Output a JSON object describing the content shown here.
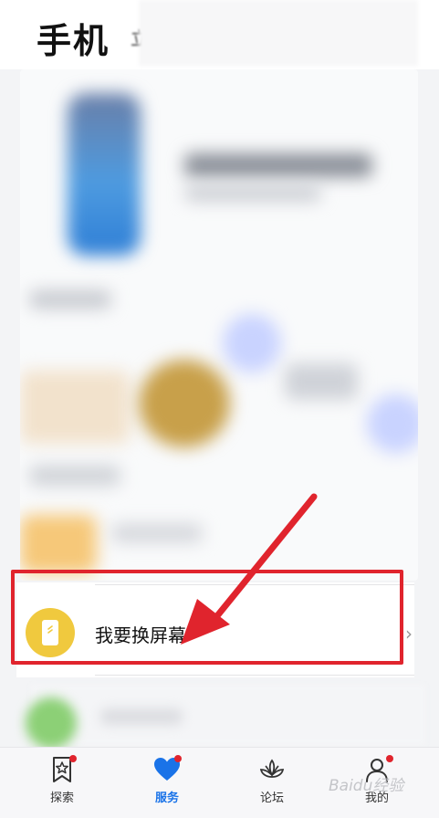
{
  "header": {
    "title": "手机",
    "extra": "立"
  },
  "list": {
    "item_label": "我要换屏幕",
    "chevron": "›"
  },
  "tabs": [
    {
      "label": "探索",
      "icon": "bookmark-star-icon",
      "badge": true
    },
    {
      "label": "服务",
      "icon": "heart-icon",
      "badge": true,
      "active": true
    },
    {
      "label": "论坛",
      "icon": "lotus-icon",
      "badge": false
    },
    {
      "label": "我的",
      "icon": "person-icon",
      "badge": true
    }
  ],
  "watermark": "Baidu经验",
  "colors": {
    "accent": "#1a73e8",
    "highlight": "#e0242d",
    "icon_yellow": "#f0c93e"
  }
}
